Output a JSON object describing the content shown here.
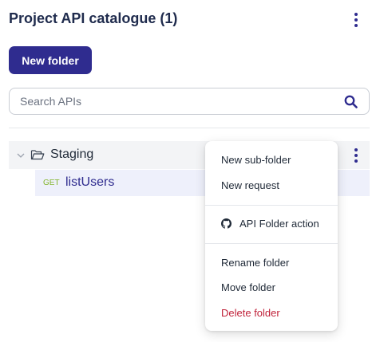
{
  "header": {
    "title": "Project API catalogue (1)",
    "new_folder_label": "New folder"
  },
  "search": {
    "placeholder": "Search APIs",
    "value": ""
  },
  "tree": {
    "folder": {
      "label": "Staging",
      "expanded": true
    },
    "request": {
      "method": "GET",
      "label": "listUsers"
    }
  },
  "context_menu": {
    "items": [
      {
        "label": "New sub-folder"
      },
      {
        "label": "New request"
      },
      {
        "label": "API Folder action",
        "icon": "github-icon"
      },
      {
        "label": "Rename folder"
      },
      {
        "label": "Move folder"
      },
      {
        "label": "Delete folder",
        "style": "danger"
      }
    ]
  },
  "colors": {
    "primary": "#2f2c8f",
    "title": "#1f2b4d",
    "method_get": "#84b52e",
    "danger": "#c0233b",
    "selected_row": "#eef0fb",
    "hover_row": "#f3f4f6"
  }
}
